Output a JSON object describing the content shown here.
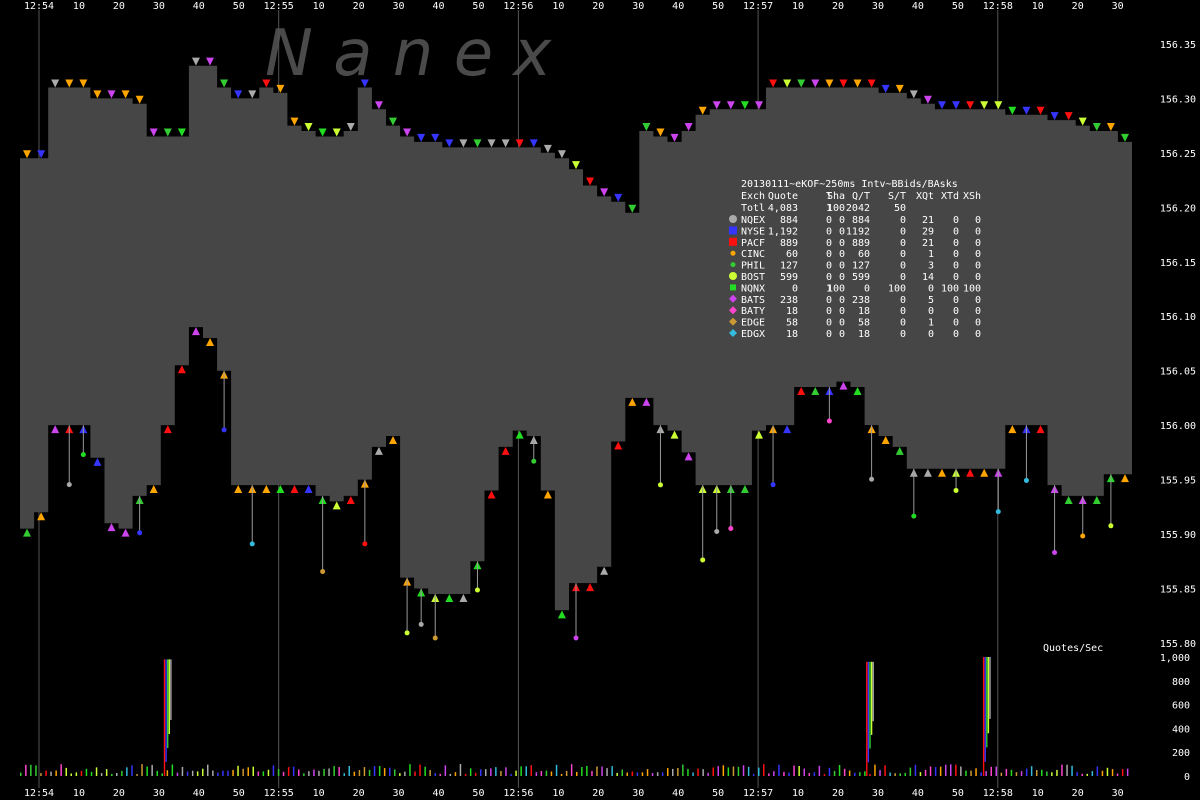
{
  "chart_data": {
    "type": "area",
    "watermark": "N a n e x",
    "price_axis": {
      "ylim": [
        155.8,
        156.36
      ],
      "ticks": [
        "156.35",
        "156.30",
        "156.25",
        "156.20",
        "156.15",
        "156.10",
        "156.05",
        "156.00",
        "155.95",
        "155.90",
        "155.85",
        "155.80"
      ]
    },
    "time_axis": {
      "ticks": [
        "12:54",
        "10",
        "20",
        "30",
        "40",
        "50",
        "12:55",
        "10",
        "20",
        "30",
        "40",
        "50",
        "12:56",
        "10",
        "20",
        "30",
        "40",
        "50",
        "12:57",
        "10",
        "20",
        "30",
        "40",
        "50",
        "12:58",
        "10",
        "20",
        "30"
      ]
    },
    "nbbo_ask": [
      156.245,
      156.245,
      156.31,
      156.31,
      156.31,
      156.3,
      156.3,
      156.3,
      156.295,
      156.265,
      156.265,
      156.265,
      156.33,
      156.33,
      156.31,
      156.3,
      156.3,
      156.31,
      156.305,
      156.275,
      156.27,
      156.265,
      156.265,
      156.27,
      156.31,
      156.29,
      156.275,
      156.265,
      156.26,
      156.26,
      156.255,
      156.255,
      156.255,
      156.255,
      156.255,
      156.255,
      156.255,
      156.25,
      156.245,
      156.235,
      156.22,
      156.21,
      156.205,
      156.195,
      156.27,
      156.265,
      156.26,
      156.27,
      156.285,
      156.29,
      156.29,
      156.29,
      156.29,
      156.31,
      156.31,
      156.31,
      156.31,
      156.31,
      156.31,
      156.31,
      156.31,
      156.305,
      156.305,
      156.3,
      156.295,
      156.29,
      156.29,
      156.29,
      156.29,
      156.29,
      156.285,
      156.285,
      156.285,
      156.28,
      156.28,
      156.275,
      156.27,
      156.27,
      156.26
    ],
    "nbbo_bid": [
      155.905,
      155.92,
      156.0,
      156.0,
      156.0,
      155.97,
      155.91,
      155.905,
      155.935,
      155.945,
      156.0,
      156.055,
      156.09,
      156.08,
      156.05,
      155.945,
      155.945,
      155.945,
      155.945,
      155.945,
      155.945,
      155.935,
      155.93,
      155.935,
      155.95,
      155.98,
      155.99,
      155.86,
      155.85,
      155.845,
      155.845,
      155.845,
      155.875,
      155.94,
      155.98,
      155.995,
      155.99,
      155.94,
      155.83,
      155.855,
      155.855,
      155.87,
      155.985,
      156.025,
      156.025,
      156.0,
      155.995,
      155.975,
      155.945,
      155.945,
      155.945,
      155.945,
      155.995,
      156.0,
      156.0,
      156.035,
      156.035,
      156.035,
      156.04,
      156.035,
      156.0,
      155.99,
      155.98,
      155.96,
      155.96,
      155.96,
      155.96,
      155.96,
      155.96,
      155.96,
      156.0,
      156.0,
      156.0,
      155.945,
      155.935,
      155.935,
      155.935,
      155.955,
      155.955
    ],
    "legend": {
      "title": "20130111~eKOF~250ms Intv~BBids/BAsks",
      "header": [
        "Exch",
        "Quote",
        "T",
        "Sha",
        "Q/T",
        "S/T",
        "XQt",
        "XTd",
        "XSh"
      ],
      "total": [
        "Totl",
        "4,083",
        "1",
        "100",
        "2042",
        "50",
        "",
        "",
        ""
      ],
      "rows": [
        {
          "name": "NQEX",
          "color": "#aaaaaa",
          "shape": "circle",
          "values": [
            "884",
            "0",
            "0",
            "884",
            "0",
            "21",
            "0",
            "0"
          ]
        },
        {
          "name": "NYSE",
          "color": "#3535ff",
          "shape": "square",
          "values": [
            "1,192",
            "0",
            "0",
            "1192",
            "0",
            "29",
            "0",
            "0"
          ]
        },
        {
          "name": "PACF",
          "color": "#ff1010",
          "shape": "square",
          "values": [
            "889",
            "0",
            "0",
            "889",
            "0",
            "21",
            "0",
            "0"
          ]
        },
        {
          "name": "CINC",
          "color": "#ffa500",
          "shape": "dot",
          "values": [
            "60",
            "0",
            "0",
            "60",
            "0",
            "1",
            "0",
            "0"
          ]
        },
        {
          "name": "PHIL",
          "color": "#33cc33",
          "shape": "dot",
          "values": [
            "127",
            "0",
            "0",
            "127",
            "0",
            "3",
            "0",
            "0"
          ]
        },
        {
          "name": "BOST",
          "color": "#ccff33",
          "shape": "circle",
          "values": [
            "599",
            "0",
            "0",
            "599",
            "0",
            "14",
            "0",
            "0"
          ]
        },
        {
          "name": "NQNX",
          "color": "#22dd22",
          "shape": "smallsquare",
          "values": [
            "0",
            "1",
            "100",
            "0",
            "100",
            "0",
            "100",
            "100"
          ]
        },
        {
          "name": "BATS",
          "color": "#cc44ee",
          "shape": "diamond",
          "values": [
            "238",
            "0",
            "0",
            "238",
            "0",
            "5",
            "0",
            "0"
          ]
        },
        {
          "name": "BATY",
          "color": "#ff44cc",
          "shape": "diamond",
          "values": [
            "18",
            "0",
            "0",
            "18",
            "0",
            "0",
            "0",
            "0"
          ]
        },
        {
          "name": "EDGE",
          "color": "#cc9933",
          "shape": "diamond",
          "values": [
            "58",
            "0",
            "0",
            "58",
            "0",
            "1",
            "0",
            "0"
          ]
        },
        {
          "name": "EDGX",
          "color": "#33bbdd",
          "shape": "diamond",
          "values": [
            "18",
            "0",
            "0",
            "18",
            "0",
            "0",
            "0",
            "0"
          ]
        }
      ]
    },
    "quotes_panel": {
      "label": "Quotes/Sec",
      "ylim": [
        0,
        1000
      ],
      "ticks": [
        "1,000",
        "800",
        "600",
        "400",
        "200",
        "0"
      ],
      "spikes": [
        {
          "t": 0.1293,
          "value": 980
        },
        {
          "t": 0.7609,
          "value": 960
        },
        {
          "t": 0.8659,
          "value": 1000
        }
      ]
    }
  }
}
